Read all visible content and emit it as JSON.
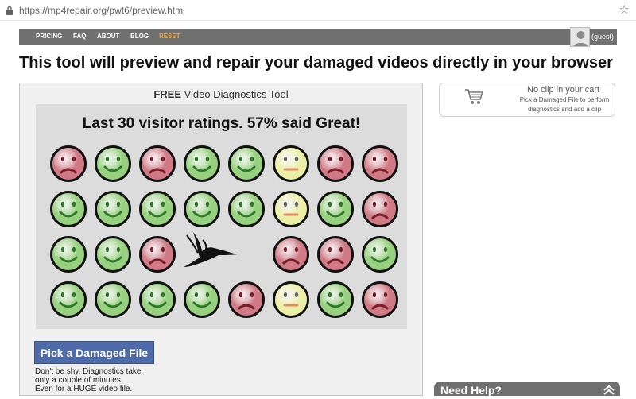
{
  "browser": {
    "url": "https://mp4repair.org/pwt6/preview.html"
  },
  "nav": {
    "items": [
      "PRICING",
      "FAQ",
      "ABOUT",
      "BLOG"
    ],
    "reset": "RESET",
    "user": "(guest)"
  },
  "headline": "This tool will preview and repair your damaged videos directly in your browser",
  "tool": {
    "title_bold": "FREE",
    "title_rest": " Video Diagnostics Tool",
    "ratings_title": "Last 30 visitor ratings. 57% said Great!",
    "ratings_rows": [
      [
        "bad",
        "great",
        "bad",
        "great",
        "great",
        "ok",
        "bad",
        "bad"
      ],
      [
        "great",
        "great",
        "great",
        "great",
        "great",
        "ok",
        "great",
        "bad"
      ],
      [
        "great",
        "great",
        "bad",
        "bird",
        "bird",
        "bad",
        "bad",
        "great"
      ],
      [
        "great",
        "great",
        "great",
        "great",
        "bad",
        "ok",
        "great",
        "bad"
      ]
    ],
    "pick_button": "Pick a Damaged File",
    "hint_lines": [
      "Don't be shy. Diagnostics take",
      "only a couple of minutes.",
      "Even for a HUGE video file."
    ]
  },
  "cart": {
    "title": "No clip in your cart",
    "subtitle": "Pick a Damaged File to perform diagnostics and add a clip"
  },
  "help": {
    "label": "Need Help?"
  },
  "colors": {
    "great": "#97d07e",
    "bad": "#cf7a85",
    "ok": "#ecefa6",
    "button": "#4f6aa8",
    "nav": "#707070",
    "reset": "#e8a43c"
  }
}
